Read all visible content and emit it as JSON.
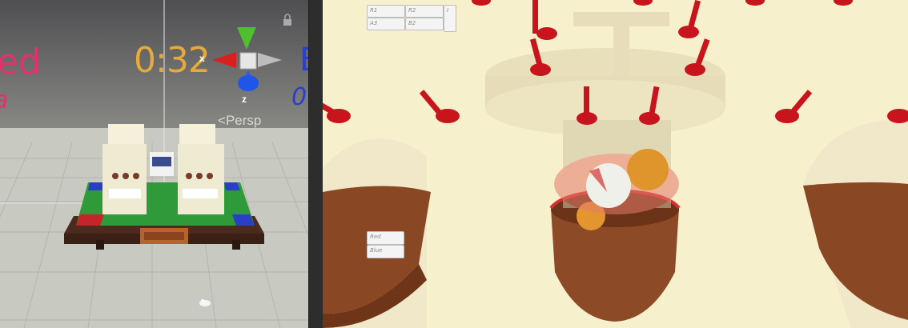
{
  "scene": {
    "timer": "0:32",
    "left_text": "ed",
    "left_text2": "a",
    "right_text": "B",
    "right_text2": "0",
    "gizmo": {
      "x_label": "x",
      "z_label": "z",
      "projection_label": "Persp"
    },
    "icons": [
      "lock-icon",
      "gizmo-icon",
      "light-icon"
    ],
    "colors": {
      "timer": "#e6a93b",
      "red_team": "#e0336e",
      "blue_team": "#2b3fc9"
    }
  },
  "game": {
    "score_table": {
      "row1": [
        "R1",
        "R2"
      ],
      "row2": [
        "A3",
        "B2"
      ],
      "side": "I"
    },
    "teams": {
      "red": "Red",
      "blue": "Blue"
    }
  }
}
